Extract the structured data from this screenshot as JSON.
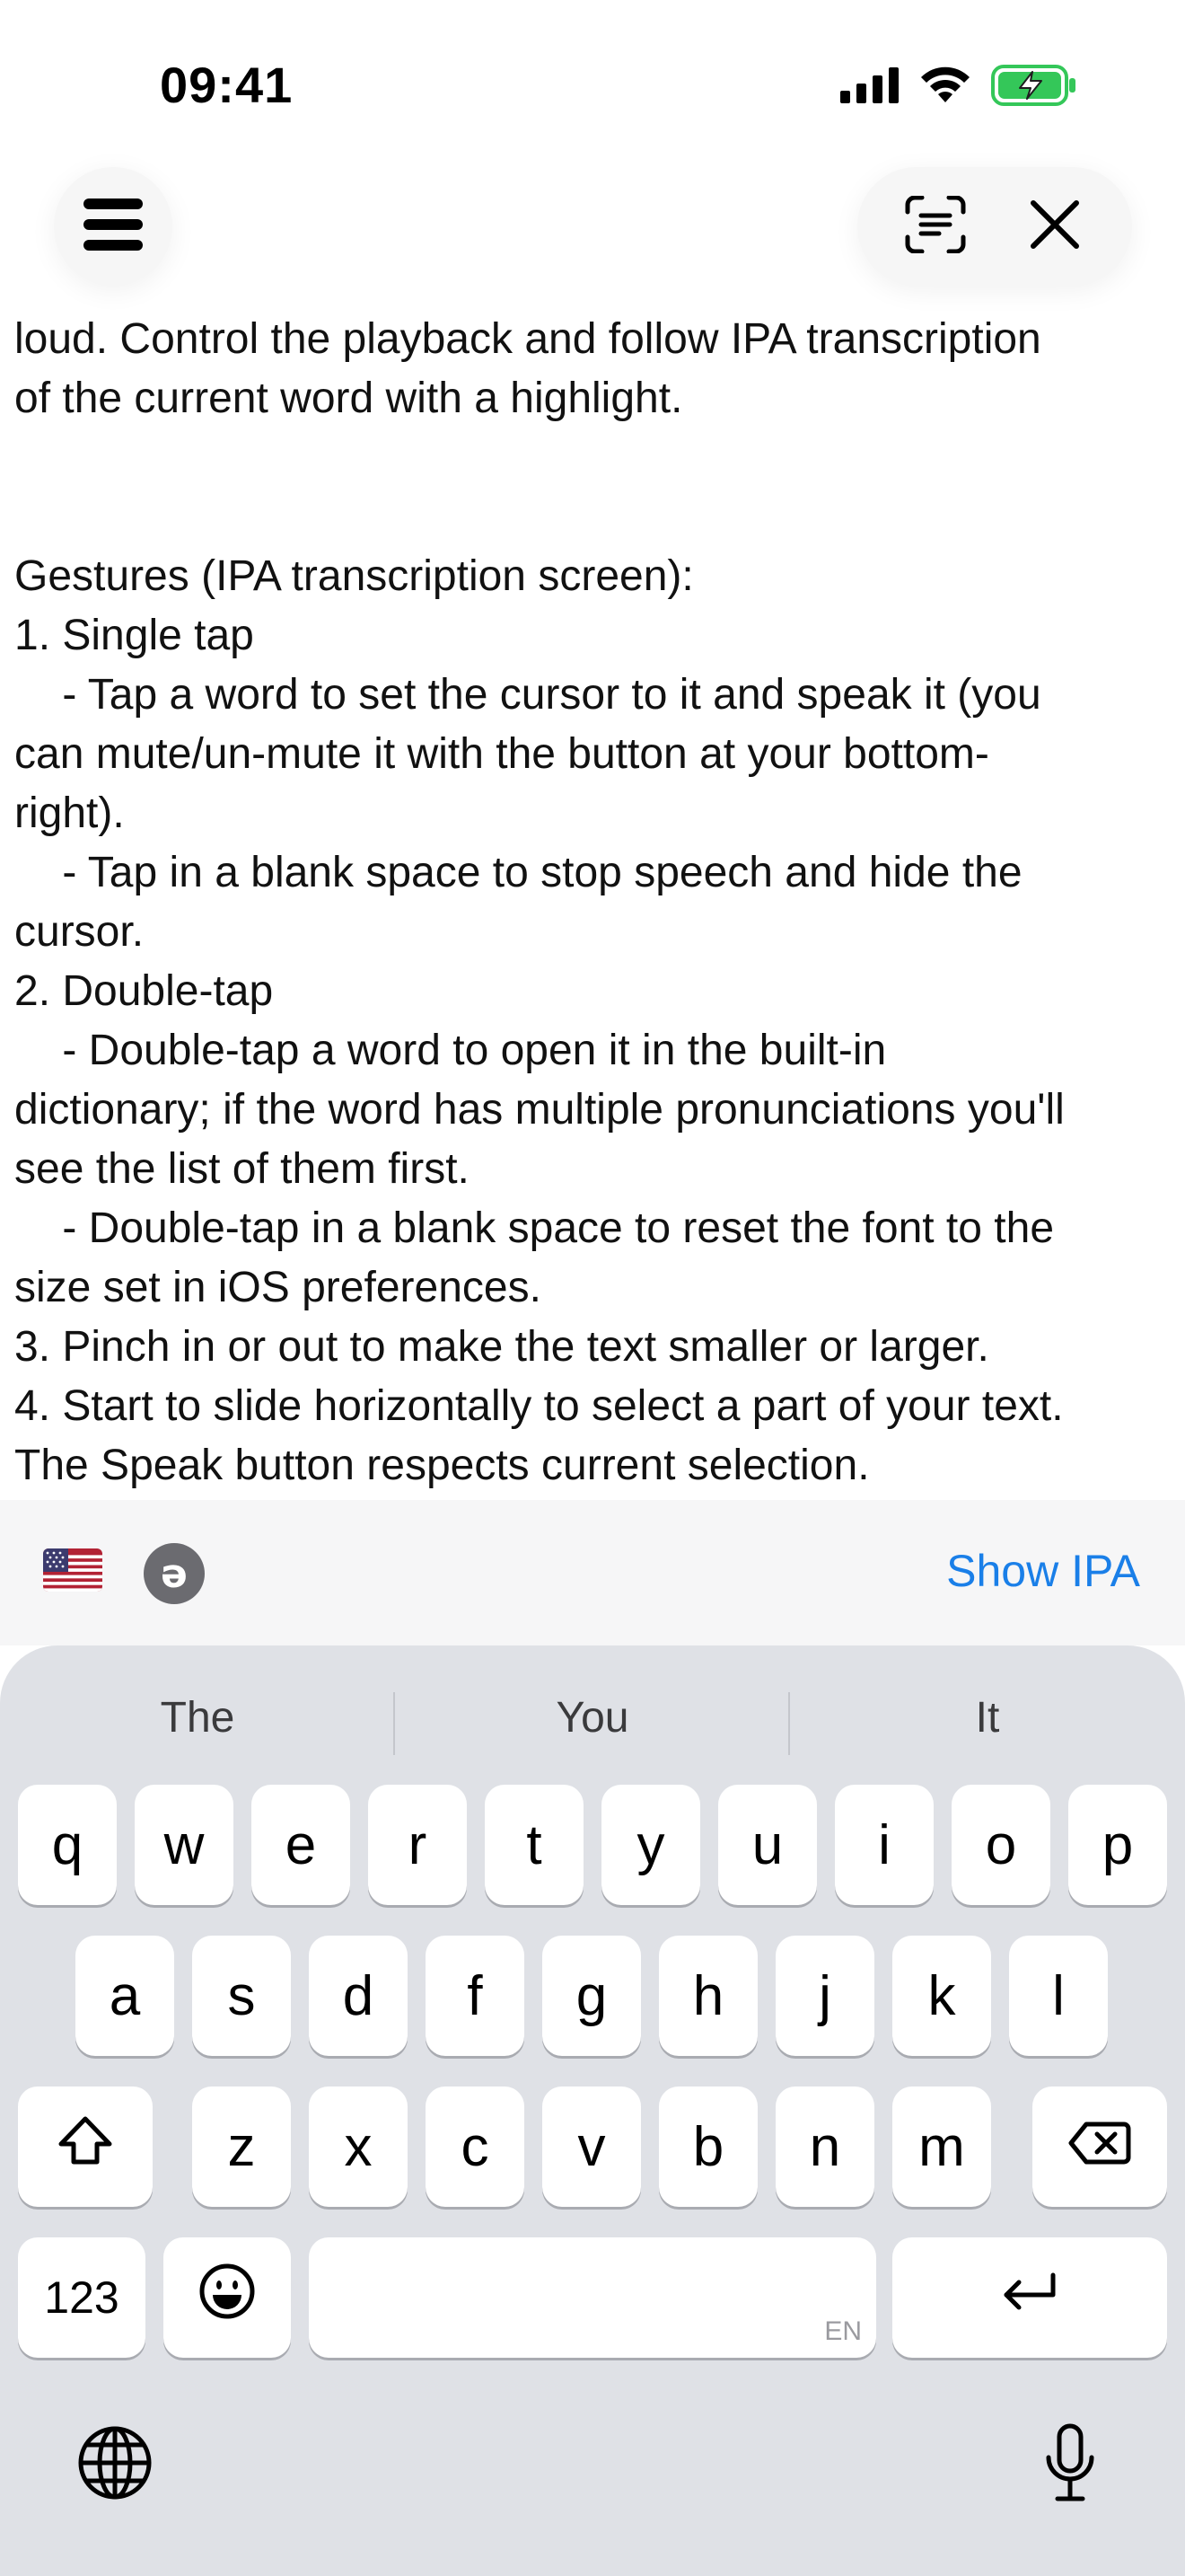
{
  "status_bar": {
    "time": "09:41"
  },
  "toolbar": {
    "menu_icon": "hamburger-menu-icon",
    "scan_icon": "text-scan-icon",
    "close_icon": "close-icon"
  },
  "content": {
    "lines": [
      "loud. Control the playback and follow IPA transcription",
      "of the current word with a highlight.",
      "",
      "",
      "Gestures (IPA transcription screen):",
      "1. Single tap",
      "    - Tap a word to set the cursor to it and speak it (you",
      "can mute/un-mute it with the button at your bottom-",
      "right).",
      "    - Tap in a blank space to stop speech and hide the",
      "cursor.",
      "2. Double-tap",
      "    - Double-tap a word to open it in the built-in",
      "dictionary; if the word has multiple pronunciations you'll",
      "see the list of them first.",
      "    - Double-tap in a blank space to reset the font to the",
      "size set in iOS preferences.",
      "3. Pinch in or out to make the text smaller or larger.",
      "4. Start to slide horizontally to select a part of your text.",
      "The Speak button respects current selection."
    ]
  },
  "accessory_bar": {
    "flag_icon": "us-flag-icon",
    "schwa_label": "ə",
    "show_ipa_label": "Show IPA",
    "accent_color": "#1a7fe8"
  },
  "keyboard": {
    "suggestions": [
      "The",
      "You",
      "It"
    ],
    "row1": [
      "q",
      "w",
      "e",
      "r",
      "t",
      "y",
      "u",
      "i",
      "o",
      "p"
    ],
    "row2": [
      "a",
      "s",
      "d",
      "f",
      "g",
      "h",
      "j",
      "k",
      "l"
    ],
    "row3": [
      "z",
      "x",
      "c",
      "v",
      "b",
      "n",
      "m"
    ],
    "numbers_label": "123",
    "space_language": "EN",
    "shift_icon": "shift-icon",
    "delete_icon": "backspace-icon",
    "emoji_icon": "emoji-icon",
    "return_icon": "return-icon",
    "globe_icon": "globe-icon",
    "mic_icon": "microphone-icon"
  }
}
